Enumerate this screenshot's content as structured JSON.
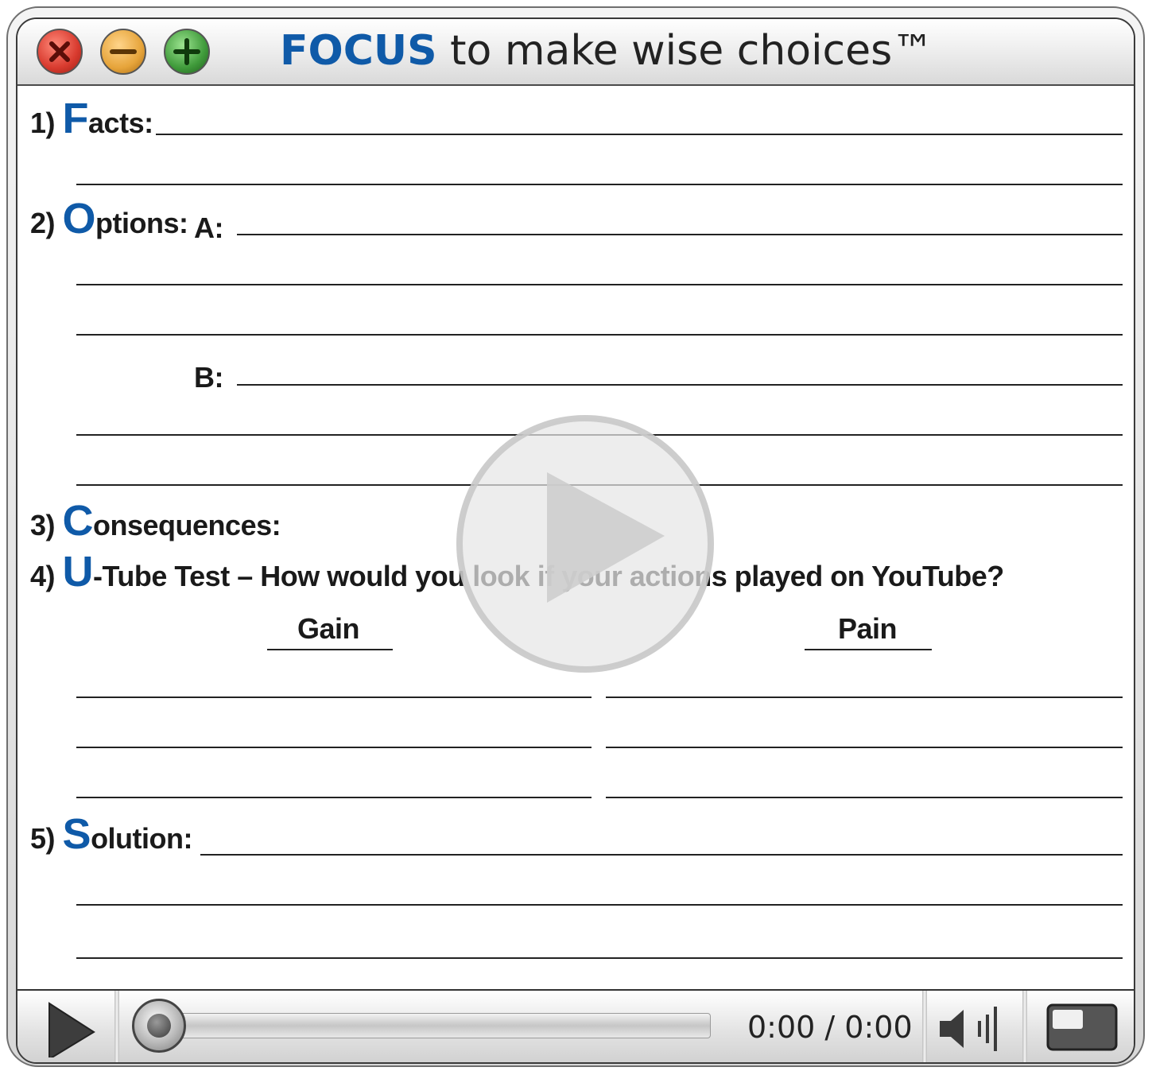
{
  "window": {
    "title_brand": "FOCUS",
    "title_rest": " to make wise choices™"
  },
  "worksheet": {
    "facts": {
      "num": "1)",
      "initial": "F",
      "rest": "acts:"
    },
    "options": {
      "num": "2)",
      "initial": "O",
      "rest": "ptions:",
      "a_label": "A:",
      "b_label": "B:"
    },
    "consequences": {
      "num": "3)",
      "initial": "C",
      "rest": "onsequences:"
    },
    "utube": {
      "num": "4)",
      "initial": "U",
      "rest": "-Tube Test – How would you look if your actions played on YouTube?"
    },
    "gain_label": "Gain",
    "pain_label": "Pain",
    "solution": {
      "num": "5)",
      "initial": "S",
      "rest": "olution:"
    }
  },
  "player": {
    "time_display": "0:00 / 0:00",
    "progress": 0
  },
  "colors": {
    "accent": "#0f5aa8",
    "close": "#d83a2e",
    "minimize": "#e6a43a",
    "maximize": "#3f9a3a"
  },
  "icons": {
    "close": "close-icon",
    "minimize": "minimize-icon",
    "maximize": "maximize-icon",
    "big_play": "play-icon",
    "play": "play-icon",
    "volume": "volume-icon",
    "fullscreen": "fullscreen-icon"
  }
}
